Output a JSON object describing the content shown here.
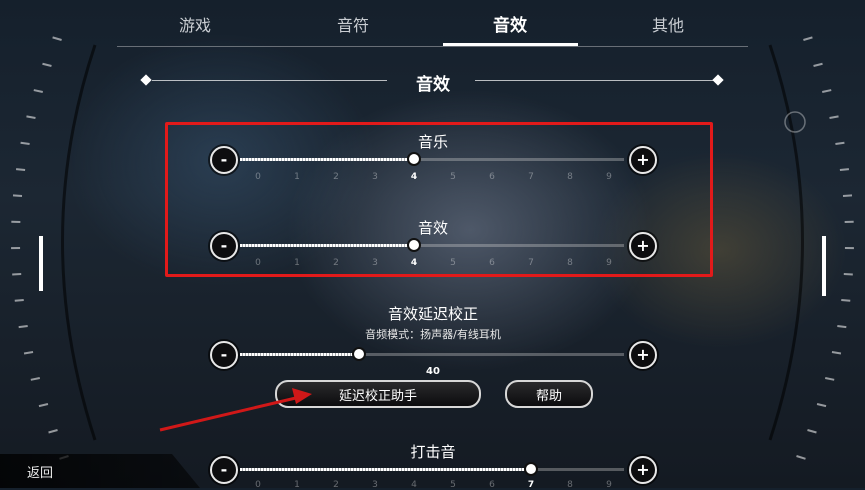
{
  "tabs": [
    {
      "label": "游戏",
      "active": false
    },
    {
      "label": "音符",
      "active": false
    },
    {
      "label": "音效",
      "active": true
    },
    {
      "label": "其他",
      "active": false
    }
  ],
  "section": {
    "title": "音效"
  },
  "sliders": {
    "music": {
      "label": "音乐",
      "value": 4,
      "min": 0,
      "max": 9,
      "ticks": [
        "0",
        "1",
        "2",
        "3",
        "4",
        "5",
        "6",
        "7",
        "8",
        "9"
      ]
    },
    "sfx": {
      "label": "音效",
      "value": 4,
      "min": 0,
      "max": 9,
      "ticks": [
        "0",
        "1",
        "2",
        "3",
        "4",
        "5",
        "6",
        "7",
        "8",
        "9"
      ]
    },
    "latency": {
      "label": "音效延迟校正",
      "sublabel": "音频模式：扬声器/有线耳机",
      "value_text": "40",
      "fraction": 0.31
    },
    "hit": {
      "label": "打击音",
      "value": 7,
      "min": 0,
      "max": 9,
      "ticks": [
        "0",
        "1",
        "2",
        "3",
        "4",
        "5",
        "6",
        "7",
        "8",
        "9"
      ]
    }
  },
  "buttons": {
    "minus": "-",
    "plus": "+",
    "calibration_assistant": "延迟校正助手",
    "help": "帮助",
    "back": "返回"
  },
  "annotation_color": "#e21a1a"
}
